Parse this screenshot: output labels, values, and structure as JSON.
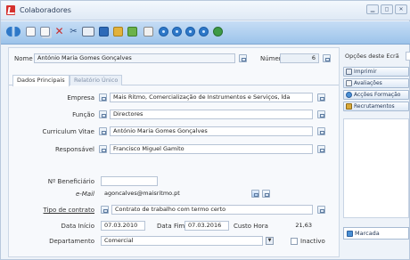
{
  "window": {
    "title": "Colaboradores"
  },
  "colors": {
    "toolbar": "#9cc3ea",
    "accent": "#2e78c8",
    "logo": "#d5312e"
  },
  "toolbar": {
    "icons": [
      "nav-arrows-icon",
      "new-document-icon",
      "copy-icon",
      "delete-icon",
      "cut-icon",
      "print-icon",
      "save-icon",
      "edit-icon",
      "search-icon",
      "first-record-icon",
      "previous-record-icon",
      "next-record-icon",
      "last-record-icon",
      "refresh-icon"
    ]
  },
  "header": {
    "nome_label": "Nome",
    "nome_value": "António Maria Gomes Gonçalves",
    "numero_label": "Número",
    "numero_value": "6"
  },
  "tabs": [
    {
      "label": "Dados Principais",
      "active": true
    },
    {
      "label": "Relatório Único",
      "active": false
    }
  ],
  "form": {
    "empresa_label": "Empresa",
    "empresa_value": "Mais Ritmo, Comercialização de Instrumentos e Serviços, lda",
    "funcao_label": "Função",
    "funcao_value": "Directores",
    "curriculum_label": "Curriculum Vitae",
    "curriculum_value": "António Maria Gomes Gonçalves",
    "responsavel_label": "Responsável",
    "responsavel_value": "Francisco Miguel Gamito",
    "beneficiario_label": "Nº Beneficiário",
    "beneficiario_value": "",
    "email_label": "e-Mail",
    "email_value": "agoncalves@maisritmo.pt",
    "contrato_label": "Tipo de contrato",
    "contrato_value": "Contrato de trabalho com termo certo",
    "data_inicio_label": "Data Início",
    "data_inicio_value": "07.03.2010",
    "data_fim_label": "Data Fim",
    "data_fim_value": "07.03.2016",
    "custo_hora_label": "Custo Hora",
    "custo_hora_value": "21,63",
    "departamento_label": "Departamento",
    "departamento_value": "Comercial",
    "inactivo_label": "Inactivo"
  },
  "sidebar": {
    "title": "Opções deste Ecrã",
    "buttons": [
      {
        "label": "Imprimir",
        "icon": "print-icon"
      },
      {
        "label": "Avaliações",
        "icon": "evaluation-icon"
      },
      {
        "label": "Acções Formação",
        "icon": "training-icon"
      },
      {
        "label": "Recrutamentos",
        "icon": "recruitment-icon"
      }
    ],
    "marcada_label": "Marcada"
  }
}
